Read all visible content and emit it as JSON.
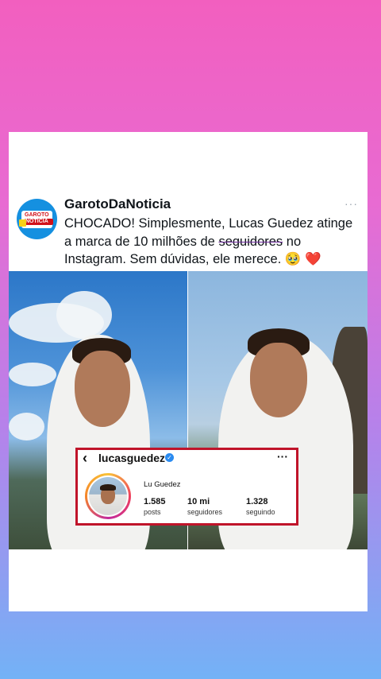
{
  "tweet": {
    "author": "GarotoDaNoticia",
    "more_icon": "···",
    "text_before": "CHOCADO! Simplesmente, Lucas Guedez atinge a marca de 10 milhões de ",
    "text_strike": "seguidores",
    "text_after": " no Instagram. Sem dúvidas, ele merece.",
    "emoji_pleading": "🥹",
    "emoji_heart": "❤️",
    "avatar_line1": "GAROTO",
    "avatar_line2": "NOTICIA"
  },
  "instagram": {
    "back_icon": "‹",
    "username": "lucasguedez",
    "verified_icon": "✓",
    "more_icon": "···",
    "display_name": "Lu Guedez",
    "stats": [
      {
        "value": "1.585",
        "label": "posts"
      },
      {
        "value": "10 mi",
        "label": "seguidores"
      },
      {
        "value": "1.328",
        "label": "seguindo"
      }
    ]
  },
  "colors": {
    "background_top": "#f25fbf",
    "background_bottom": "#73b2f6",
    "highlight_border": "#c0142a",
    "verified": "#2b8bf0"
  }
}
